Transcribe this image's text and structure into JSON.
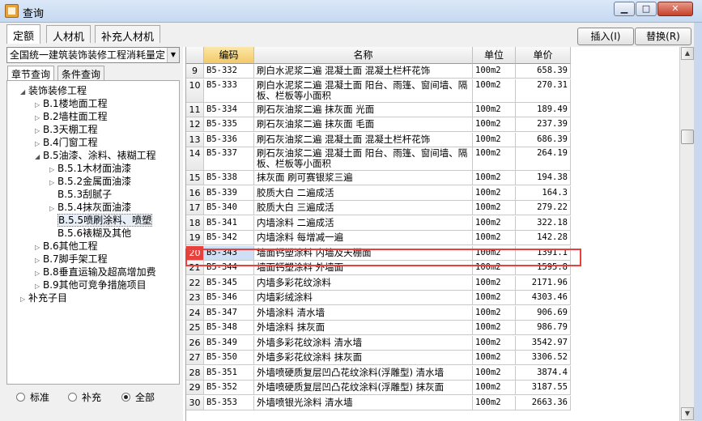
{
  "window": {
    "title": "查询",
    "min_glyph": "▁",
    "max_glyph": "□",
    "close_glyph": "✕"
  },
  "top_tabs": [
    "定额",
    "人材机",
    "补充人材机"
  ],
  "buttons": {
    "insert": "插入(I)",
    "replace": "替换(R)"
  },
  "combo": {
    "value": "全国统一建筑装饰装修工程消耗量定",
    "arrow": "▼"
  },
  "sub_tabs": [
    "章节查询",
    "条件查询"
  ],
  "tree": [
    {
      "label": "装饰装修工程",
      "toggle": "◢"
    },
    {
      "label": "B.1楼地面工程",
      "toggle": "▷"
    },
    {
      "label": "B.2墙柱面工程",
      "toggle": "▷"
    },
    {
      "label": "B.3天棚工程",
      "toggle": "▷"
    },
    {
      "label": "B.4门窗工程",
      "toggle": "▷"
    },
    {
      "label": "B.5油漆、涂料、裱糊工程",
      "toggle": "◢"
    },
    {
      "label": "B.5.1木材面油漆",
      "toggle": "▷"
    },
    {
      "label": "B.5.2金属面油漆",
      "toggle": "▷"
    },
    {
      "label": "B.5.3刮腻子",
      "toggle": ""
    },
    {
      "label": "B.5.4抹灰面油漆",
      "toggle": "▷"
    },
    {
      "label": "B.5.5喷刷涂料、喷塑",
      "toggle": ""
    },
    {
      "label": "B.5.6裱糊及其他",
      "toggle": ""
    },
    {
      "label": "B.6其他工程",
      "toggle": "▷"
    },
    {
      "label": "B.7脚手架工程",
      "toggle": "▷"
    },
    {
      "label": "B.8垂直运输及超高增加费",
      "toggle": "▷"
    },
    {
      "label": "B.9其他可竞争措施项目",
      "toggle": "▷"
    },
    {
      "label": "补充子目",
      "toggle": "▷"
    }
  ],
  "radios": [
    {
      "label": "标准",
      "checked": false
    },
    {
      "label": "补充",
      "checked": false
    },
    {
      "label": "全部",
      "checked": true
    }
  ],
  "table": {
    "headers": [
      "",
      "编码",
      "名称",
      "单位",
      "单价"
    ],
    "rows": [
      {
        "n": "9",
        "code": "B5-332",
        "name": "刷白水泥浆二遍 混凝土面 混凝土栏杆花饰",
        "unit": "100m2",
        "price": "658.39",
        "tall": false
      },
      {
        "n": "10",
        "code": "B5-333",
        "name": "刷白水泥浆二遍 混凝土面 阳台、雨篷、窗间墙、隔板、栏板等小面积",
        "unit": "100m2",
        "price": "270.31",
        "tall": true
      },
      {
        "n": "11",
        "code": "B5-334",
        "name": "刷石灰油浆二遍 抹灰面 光面",
        "unit": "100m2",
        "price": "189.49",
        "tall": false
      },
      {
        "n": "12",
        "code": "B5-335",
        "name": "刷石灰油浆二遍 抹灰面 毛面",
        "unit": "100m2",
        "price": "237.39",
        "tall": false
      },
      {
        "n": "13",
        "code": "B5-336",
        "name": "刷石灰油浆二遍 混凝土面 混凝土栏杆花饰",
        "unit": "100m2",
        "price": "686.39",
        "tall": false
      },
      {
        "n": "14",
        "code": "B5-337",
        "name": "刷石灰油浆二遍 混凝土面 阳台、雨篷、窗间墙、隔板、栏板等小面积",
        "unit": "100m2",
        "price": "264.19",
        "tall": true
      },
      {
        "n": "15",
        "code": "B5-338",
        "name": "抹灰面 刷可赛银浆三遍",
        "unit": "100m2",
        "price": "194.38",
        "tall": false
      },
      {
        "n": "16",
        "code": "B5-339",
        "name": "胶质大白 二遍成活",
        "unit": "100m2",
        "price": "164.3",
        "tall": false
      },
      {
        "n": "17",
        "code": "B5-340",
        "name": "胶质大白 三遍成活",
        "unit": "100m2",
        "price": "279.22",
        "tall": false
      },
      {
        "n": "18",
        "code": "B5-341",
        "name": "内墙涂料 二遍成活",
        "unit": "100m2",
        "price": "322.18",
        "tall": false
      },
      {
        "n": "19",
        "code": "B5-342",
        "name": "内墙涂料 每增减一遍",
        "unit": "100m2",
        "price": "142.28",
        "tall": false
      },
      {
        "n": "20",
        "code": "B5-343",
        "name": "墙面钙塑涂料 内墙及天棚面",
        "unit": "100m2",
        "price": "1391.1",
        "tall": false,
        "selected": true
      },
      {
        "n": "21",
        "code": "B5-344",
        "name": "墙面钙塑涂料 外墙面",
        "unit": "100m2",
        "price": "1595.8",
        "tall": false
      },
      {
        "n": "22",
        "code": "B5-345",
        "name": "内墙多彩花纹涂料",
        "unit": "100m2",
        "price": "2171.96",
        "tall": false
      },
      {
        "n": "23",
        "code": "B5-346",
        "name": "内墙彩绒涂料",
        "unit": "100m2",
        "price": "4303.46",
        "tall": false
      },
      {
        "n": "24",
        "code": "B5-347",
        "name": "外墙涂料 清水墙",
        "unit": "100m2",
        "price": "906.69",
        "tall": false
      },
      {
        "n": "25",
        "code": "B5-348",
        "name": "外墙涂料 抹灰面",
        "unit": "100m2",
        "price": "986.79",
        "tall": false
      },
      {
        "n": "26",
        "code": "B5-349",
        "name": "外墙多彩花纹涂料 清水墙",
        "unit": "100m2",
        "price": "3542.97",
        "tall": false
      },
      {
        "n": "27",
        "code": "B5-350",
        "name": "外墙多彩花纹涂料 抹灰面",
        "unit": "100m2",
        "price": "3306.52",
        "tall": false
      },
      {
        "n": "28",
        "code": "B5-351",
        "name": "外墙喷硬质复层凹凸花纹涂料(浮雕型) 清水墙",
        "unit": "100m2",
        "price": "3874.4",
        "tall": false
      },
      {
        "n": "29",
        "code": "B5-352",
        "name": "外墙喷硬质复层凹凸花纹涂料(浮雕型) 抹灰面",
        "unit": "100m2",
        "price": "3187.55",
        "tall": false
      },
      {
        "n": "30",
        "code": "B5-353",
        "name": "外墙喷银光涂料 清水墙",
        "unit": "100m2",
        "price": "2663.36",
        "tall": false
      }
    ]
  },
  "scrollbar": {
    "up": "▲",
    "down": "▼"
  },
  "colors": {
    "selection_marker": "#e8413b",
    "sorted_header": "#f3c969",
    "selected_code": "#cfe0f6"
  }
}
